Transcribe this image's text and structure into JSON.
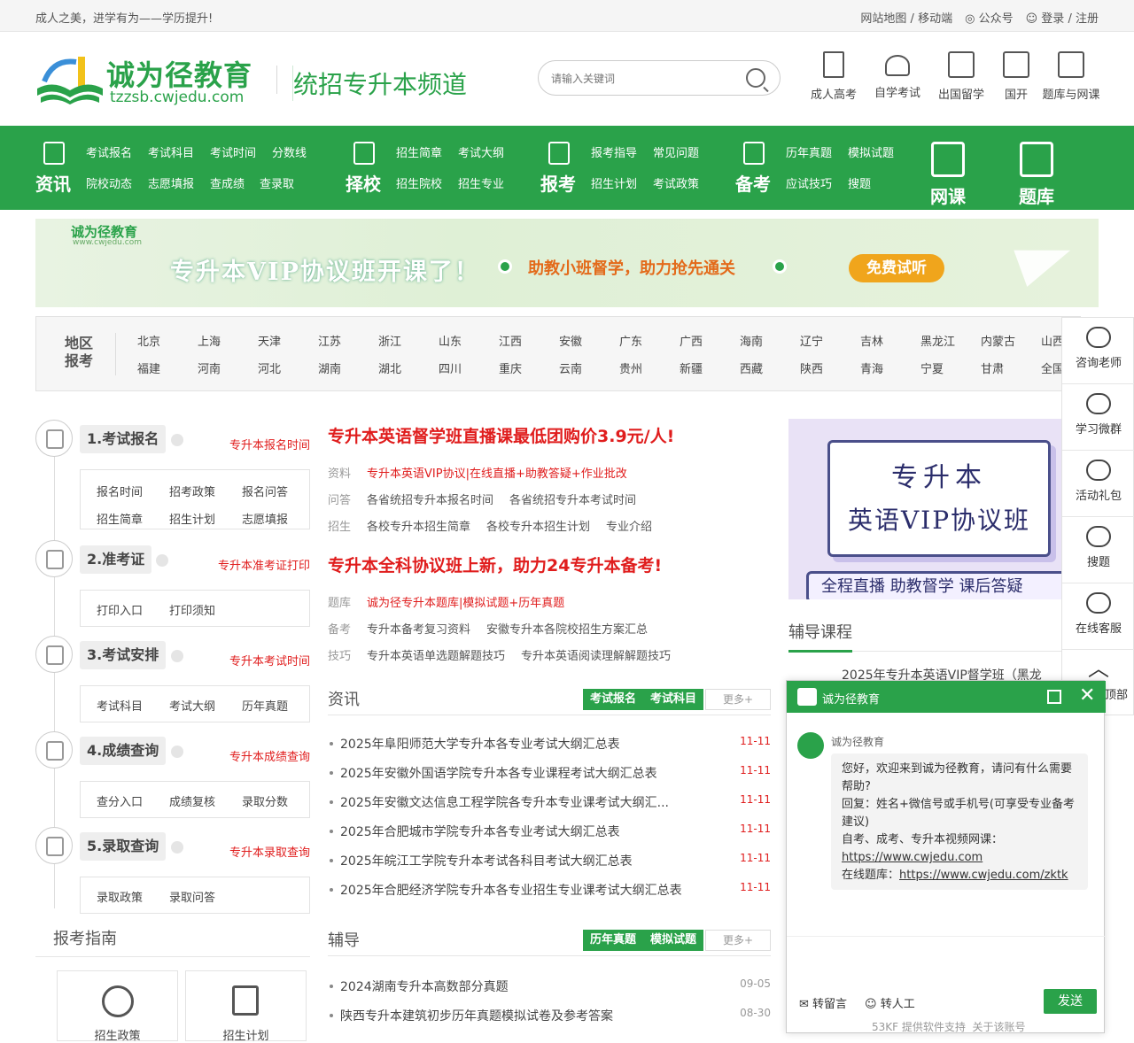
{
  "topbar": {
    "slogan": "成人之美，进学有为——学历提升!",
    "sitemap": "网站地图",
    "slash1": "/",
    "mobile": "移动端",
    "wechat": "公众号",
    "login": "登录",
    "slash2": "/",
    "register": "注册"
  },
  "header": {
    "brand": "诚为径教育",
    "domain": "tzzsb.cwjedu.com",
    "channel": "统招专升本频道",
    "search_placeholder": "请输入关键词",
    "nav": [
      "成人高考",
      "自学考试",
      "出国留学",
      "国开",
      "题库与网课"
    ]
  },
  "greennav": {
    "sections": [
      {
        "big": "资讯",
        "links": [
          "考试报名",
          "考试科目",
          "考试时间",
          "分数线",
          "院校动态",
          "志愿填报",
          "查成绩",
          "查录取"
        ]
      },
      {
        "big": "择校",
        "links": [
          "招生简章",
          "考试大纲",
          "招生院校",
          "招生专业"
        ]
      },
      {
        "big": "报考",
        "links": [
          "报考指导",
          "常见问题",
          "招生计划",
          "考试政策"
        ]
      },
      {
        "big": "备考",
        "links": [
          "历年真题",
          "模拟试题",
          "应试技巧",
          "搜题"
        ]
      }
    ],
    "online_course": "网课",
    "question_bank": "题库"
  },
  "banner": {
    "logo": "诚为径教育",
    "domain": "www.cwjedu.com",
    "title": "专升本VIP协议班开课了！",
    "subtitle": "助教小班督学，助力抢先通关",
    "button": "免费试听"
  },
  "region": {
    "label1": "地区",
    "label2": "报考",
    "row1": [
      "北京",
      "上海",
      "天津",
      "江苏",
      "浙江",
      "山东",
      "江西",
      "安徽",
      "广东",
      "广西",
      "海南",
      "辽宁",
      "吉林",
      "黑龙江",
      "内蒙古",
      "山西"
    ],
    "row2": [
      "福建",
      "河南",
      "河北",
      "湖南",
      "湖北",
      "四川",
      "重庆",
      "云南",
      "贵州",
      "新疆",
      "西藏",
      "陕西",
      "青海",
      "宁夏",
      "甘肃",
      "全国"
    ]
  },
  "steps": [
    {
      "title": "1.考试报名",
      "link": "专升本报名时间",
      "items": [
        "报名时间",
        "招考政策",
        "报名问答",
        "招生简章",
        "招生计划",
        "志愿填报"
      ]
    },
    {
      "title": "2.准考证",
      "link": "专升本准考证打印",
      "items": [
        "打印入口",
        "打印须知"
      ]
    },
    {
      "title": "3.考试安排",
      "link": "专升本考试时间",
      "items": [
        "考试科目",
        "考试大纲",
        "历年真题"
      ]
    },
    {
      "title": "4.成绩查询",
      "link": "专升本成绩查询",
      "items": [
        "查分入口",
        "成绩复核",
        "录取分数"
      ]
    },
    {
      "title": "5.录取查询",
      "link": "专升本录取查询",
      "items": [
        "录取政策",
        "录取问答"
      ]
    }
  ],
  "news": {
    "headline1": "专升本英语督学班直播课最低团购价3.9元/人!",
    "rows1": [
      {
        "key": "资料",
        "links": [
          "专升本英语VIP协议|在线直播+助教答疑+作业批改"
        ],
        "red": true
      },
      {
        "key": "问答",
        "links": [
          "各省统招专升本报名时间",
          "各省统招专升本考试时间"
        ],
        "red": false
      },
      {
        "key": "招生",
        "links": [
          "各校专升本招生简章",
          "各校专升本招生计划",
          "专业介绍"
        ],
        "red": false
      }
    ],
    "headline2": "专升本全科协议班上新，助力24专升本备考!",
    "rows2": [
      {
        "key": "题库",
        "links": [
          "诚为径专升本题库|模拟试题+历年真题"
        ],
        "red": true
      },
      {
        "key": "备考",
        "links": [
          "专升本备考复习资料",
          "安徽专升本各院校招生方案汇总"
        ],
        "red": false
      },
      {
        "key": "技巧",
        "links": [
          "专升本英语单选题解题技巧",
          "专升本英语阅读理解解题技巧"
        ],
        "red": false
      }
    ]
  },
  "zixun": {
    "title": "资讯",
    "tabs": [
      "考试报名",
      "考试科目"
    ],
    "more": "更多+",
    "items": [
      {
        "text": "2025年阜阳师范大学专升本各专业考试大纲汇总表",
        "date": "11-11"
      },
      {
        "text": "2025年安徽外国语学院专升本各专业课程考试大纲汇总表",
        "date": "11-11"
      },
      {
        "text": "2025年安徽文达信息工程学院各专升本专业课考试大纲汇...",
        "date": "11-11"
      },
      {
        "text": "2025年合肥城市学院专升本各专业考试大纲汇总表",
        "date": "11-11"
      },
      {
        "text": "2025年皖江工学院专升本考试各科目考试大纲汇总表",
        "date": "11-11"
      },
      {
        "text": "2025年合肥经济学院专升本各专业招生专业课考试大纲汇总表",
        "date": "11-11"
      }
    ]
  },
  "fudao": {
    "title": "辅导",
    "tabs": [
      "历年真题",
      "模拟试题"
    ],
    "more": "更多+",
    "items": [
      {
        "text": "2024湖南专升本高数部分真题",
        "date": "09-05"
      },
      {
        "text": "陕西专升本建筑初步历年真题模拟试卷及参考答案",
        "date": "08-30"
      }
    ]
  },
  "ad": {
    "line1": "专升本",
    "line2": "英语VIP协议班",
    "ribbon": "全程直播 助教督学 课后答疑"
  },
  "courses": {
    "title": "辅导课程",
    "item1": "2025年专升本英语VIP督学班（黑龙"
  },
  "guide": {
    "title": "报考指南",
    "cards": [
      "招生政策",
      "招生计划"
    ]
  },
  "side": {
    "items": [
      "咨询老师",
      "学习微群",
      "活动礼包",
      "搜题",
      "在线客服",
      "顶部"
    ]
  },
  "chat": {
    "title": "诚为径教育",
    "agent": "诚为径教育",
    "msg1": "您好，欢迎来到诚为径教育，请问有什么需要帮助?",
    "msg2": "回复：姓名+微信号或手机号(可享受专业备考建议)",
    "msg3": "自考、成考、专升本视频网课：",
    "url1": "https://www.cwjedu.com",
    "msg4": "在线题库：",
    "url2": "https://www.cwjedu.com/zktk",
    "leave_msg": "转留言",
    "to_human": "转人工",
    "send": "发送",
    "footer": "53KF 提供软件支持",
    "about": "关于该账号"
  },
  "colors": {
    "primary": "#2aa24a",
    "red": "#e01d1d"
  }
}
